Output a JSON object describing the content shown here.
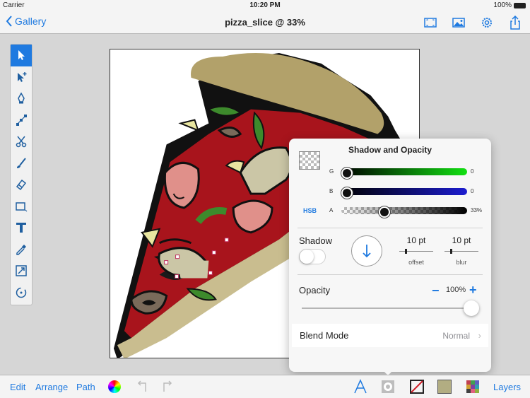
{
  "status_bar": {
    "carrier": "Carrier",
    "time": "10:20 PM",
    "battery": "100%"
  },
  "navbar": {
    "back_label": "Gallery",
    "title": "pizza_slice @ 33%",
    "icons": [
      "fit-screen-icon",
      "image-icon",
      "gear-icon",
      "share-icon"
    ]
  },
  "toolbox": {
    "tools": [
      "select",
      "direct-select",
      "pen",
      "node-edit",
      "scissors",
      "brush",
      "eraser",
      "shape",
      "text",
      "eyedropper",
      "scale",
      "rotate"
    ],
    "active_tool": "select"
  },
  "panel": {
    "title": "Shadow and Opacity",
    "sliders": [
      {
        "label": "G",
        "value": "0",
        "fraction": 0.0,
        "color": "#12e012"
      },
      {
        "label": "B",
        "value": "0",
        "fraction": 0.0,
        "color": "#1c1cd0"
      },
      {
        "label": "A",
        "value": "33%",
        "fraction": 0.33,
        "color": "#000000"
      }
    ],
    "hsb_label": "HSB",
    "shadow": {
      "label": "Shadow",
      "enabled": false,
      "offset_value": "10 pt",
      "offset_caption": "offset",
      "blur_value": "10 pt",
      "blur_caption": "blur"
    },
    "opacity": {
      "label": "Opacity",
      "minus": "−",
      "value": "100%",
      "plus": "+",
      "fraction": 1.0
    },
    "blend": {
      "label": "Blend Mode",
      "value": "Normal",
      "chevron": "›"
    }
  },
  "bottom_bar": {
    "edit_label": "Edit",
    "arrange_label": "Arrange",
    "path_label": "Path",
    "layers_label": "Layers",
    "fill_color": "#b2ad82"
  },
  "colors": {
    "accent": "#1f7ae0",
    "crust": "#b2a16a",
    "sauce": "#a8141c",
    "mushroom": "#cbc6a6"
  }
}
